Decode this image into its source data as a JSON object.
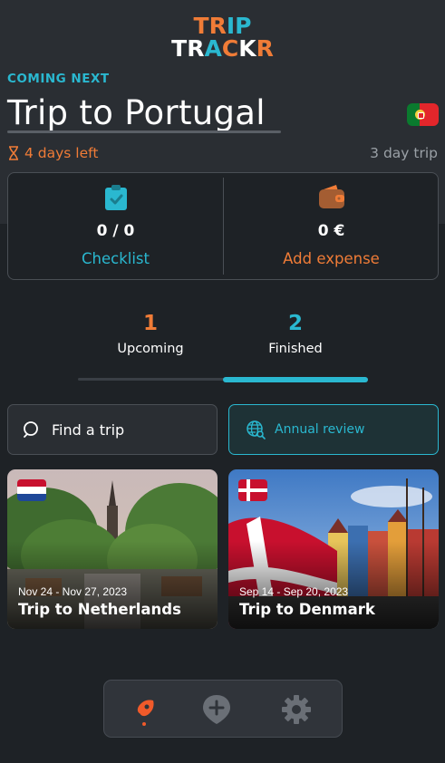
{
  "app": {
    "logo_line1": [
      "T",
      "R",
      "I",
      "P"
    ],
    "logo_line2": [
      "T",
      "R",
      "A",
      "C",
      "K",
      "R"
    ]
  },
  "next_trip": {
    "eyebrow": "COMING NEXT",
    "title": "Trip to Portugal",
    "countdown": "4 days left",
    "duration": "3 day trip"
  },
  "stats": {
    "checklist_value": "0 / 0",
    "checklist_label": "Checklist",
    "expense_value": "0 €",
    "expense_label": "Add expense"
  },
  "tabs": [
    {
      "count": "1",
      "label": "Upcoming"
    },
    {
      "count": "2",
      "label": "Finished",
      "selected": true
    }
  ],
  "search": {
    "placeholder": "Find a trip"
  },
  "annual_review": {
    "label": "Annual review"
  },
  "trips": [
    {
      "dates": "Nov 24 - Nov 27, 2023",
      "title": "Trip to Netherlands",
      "flag": "netherlands"
    },
    {
      "dates": "Sep 14 - Sep 20, 2023",
      "title": "Trip to Denmark",
      "flag": "denmark"
    }
  ],
  "nav": [
    {
      "icon": "rocket-icon",
      "active": true
    },
    {
      "icon": "add-location-icon",
      "active": false
    },
    {
      "icon": "gear-icon",
      "active": false
    }
  ],
  "colors": {
    "accent_orange": "#f07c37",
    "accent_cyan": "#2ab8d0",
    "background": "#1e2226"
  }
}
